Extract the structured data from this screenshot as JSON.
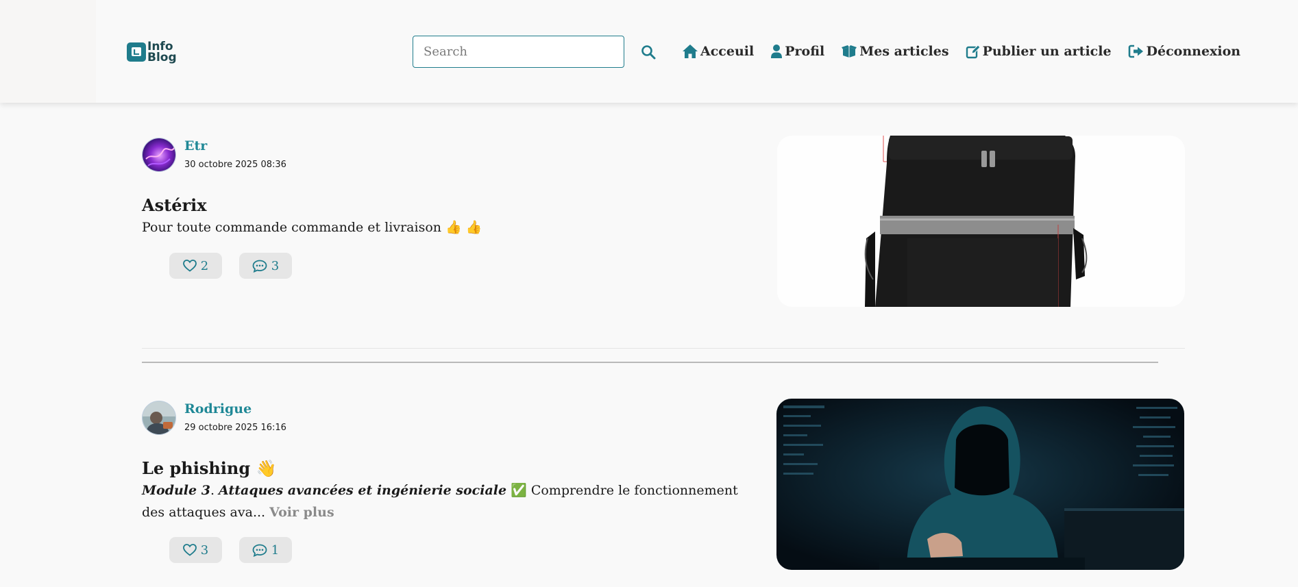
{
  "brand": {
    "logo_text_line1": "Info",
    "logo_text_line2": "Blog",
    "accent": "#1f7c8c"
  },
  "search": {
    "placeholder": "Search",
    "value": ""
  },
  "nav": [
    {
      "label": "Acceuil",
      "icon": "home-icon"
    },
    {
      "label": "Profil",
      "icon": "user-icon"
    },
    {
      "label": "Mes articles",
      "icon": "box-open-icon"
    },
    {
      "label": "Publier un article",
      "icon": "edit-icon"
    },
    {
      "label": "Déconnexion",
      "icon": "logout-icon"
    }
  ],
  "posts": [
    {
      "author": "Etr",
      "date": "30 octobre 2025 08:36",
      "title": "Astérix",
      "body": "Pour toute commande commande et livraison",
      "body_emoji": "👍 👍",
      "likes": "2",
      "comments": "3",
      "image": "black-delivery-backpack"
    },
    {
      "author": "Rodrigue",
      "date": "29 octobre 2025 16:16",
      "title": "Le phishing",
      "title_emoji": "👋",
      "body_em_1": "Module 3",
      "body_sep": ". ",
      "body_em_2": "Attaques avancées et ingénierie sociale",
      "body_check": "✅",
      "body_text": " Comprendre le fonctionnement des attaques ava...",
      "see_more": "Voir plus",
      "likes": "3",
      "comments": "1",
      "image": "hooded-hacker-at-laptop"
    }
  ]
}
